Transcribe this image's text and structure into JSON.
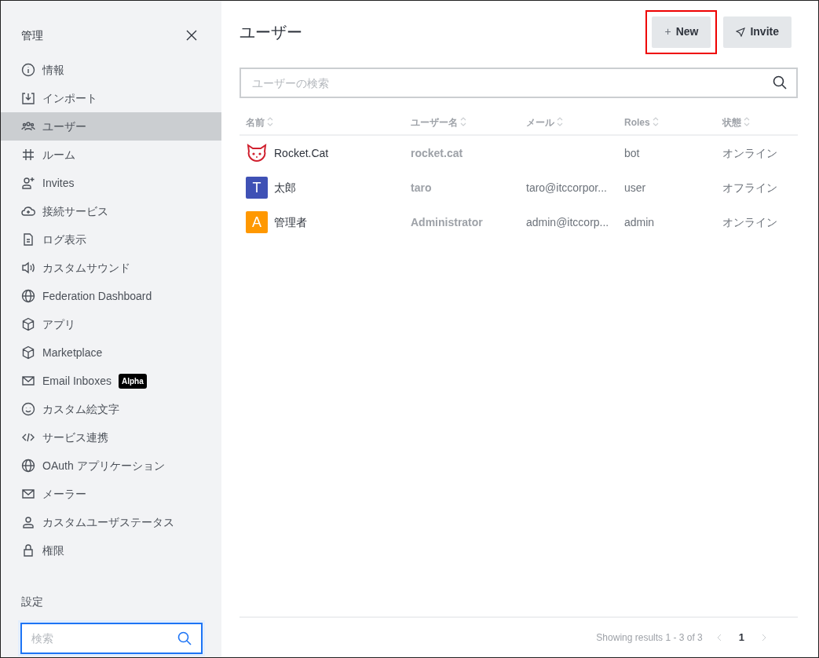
{
  "sidebar": {
    "title": "管理",
    "items": [
      {
        "label": "情報",
        "selected": false
      },
      {
        "label": "インポート",
        "selected": false
      },
      {
        "label": "ユーザー",
        "selected": true
      },
      {
        "label": "ルーム",
        "selected": false
      },
      {
        "label": "Invites",
        "selected": false
      },
      {
        "label": "接続サービス",
        "selected": false
      },
      {
        "label": "ログ表示",
        "selected": false
      },
      {
        "label": "カスタムサウンド",
        "selected": false
      },
      {
        "label": "Federation Dashboard",
        "selected": false
      },
      {
        "label": "アプリ",
        "selected": false
      },
      {
        "label": "Marketplace",
        "selected": false
      },
      {
        "label": "Email Inboxes",
        "selected": false,
        "badge": "Alpha"
      },
      {
        "label": "カスタム絵文字",
        "selected": false
      },
      {
        "label": "サービス連携",
        "selected": false
      },
      {
        "label": "OAuth アプリケーション",
        "selected": false
      },
      {
        "label": "メーラー",
        "selected": false
      },
      {
        "label": "カスタムユーザステータス",
        "selected": false
      },
      {
        "label": "権限",
        "selected": false
      }
    ],
    "settings_label": "設定",
    "settings_search": {
      "placeholder": "検索"
    }
  },
  "page": {
    "title": "ユーザー",
    "buttons": [
      {
        "label": "New",
        "symbol": "+",
        "highlighted": true
      },
      {
        "label": "Invite",
        "highlighted": false
      }
    ],
    "search": {
      "placeholder": "ユーザーの検索"
    },
    "table": {
      "columns": [
        "名前",
        "ユーザー名",
        "メール",
        "Roles",
        "状態"
      ],
      "rows": [
        {
          "avatar": {
            "kind": "cat"
          },
          "name": "Rocket.Cat",
          "username": "rocket.cat",
          "email": "",
          "roles": "bot",
          "status": "オンライン"
        },
        {
          "avatar": {
            "kind": "letter",
            "letter": "T",
            "color": "#3f51b5"
          },
          "name": "太郎",
          "username": "taro",
          "email": "taro@itccorpor...",
          "roles": "user",
          "status": "オフライン"
        },
        {
          "avatar": {
            "kind": "letter",
            "letter": "A",
            "color": "#ff9800"
          },
          "name": "管理者",
          "username": "Administrator",
          "email": "admin@itccorp...",
          "roles": "admin",
          "status": "オンライン"
        }
      ]
    },
    "pagination": {
      "summary": "Showing results 1 - 3 of 3",
      "pages": [
        {
          "label": "1",
          "selected": true
        }
      ]
    }
  }
}
